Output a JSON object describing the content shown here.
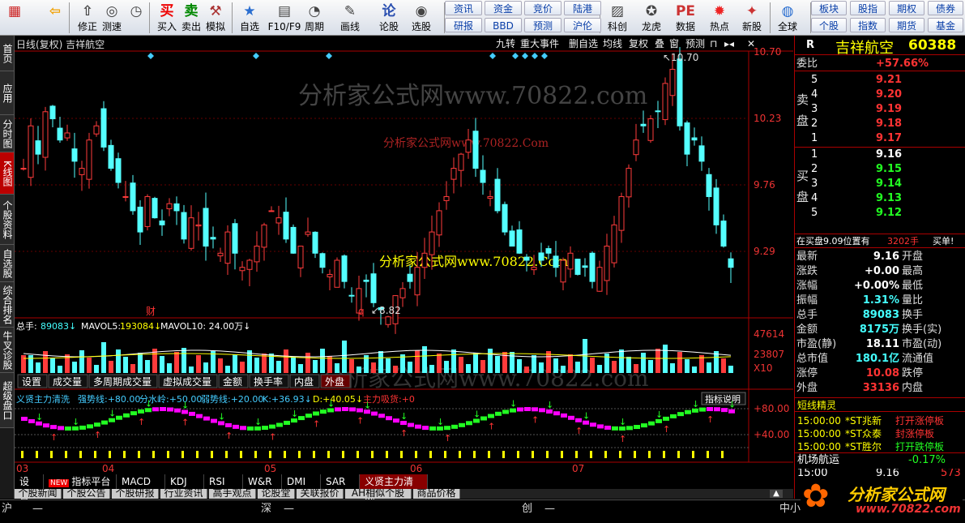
{
  "toolbar": {
    "buttons": [
      {
        "label": "",
        "icon": "grid-icon"
      },
      {
        "label": "",
        "icon": "back-arrow-icon"
      },
      {
        "label": "修正",
        "icon": "up-arrow-icon"
      },
      {
        "label": "测速",
        "icon": "bulb-icon"
      },
      {
        "label": "",
        "icon": "clock-icon"
      },
      {
        "label": "买入",
        "icon": "buy-icon",
        "glyph": "买"
      },
      {
        "label": "卖出",
        "icon": "sell-icon",
        "glyph": "卖"
      },
      {
        "label": "模拟",
        "icon": "hammer-icon"
      },
      {
        "label": "自选",
        "icon": "star-icon"
      },
      {
        "label": "F10/F9",
        "icon": "f10-icon"
      },
      {
        "label": "周期",
        "icon": "cycle-icon"
      },
      {
        "label": "画线",
        "icon": "pen-icon"
      },
      {
        "label": "论股",
        "icon": "chat-icon",
        "glyph": "论"
      },
      {
        "label": "选股",
        "icon": "select-icon"
      },
      {
        "label": "科创",
        "icon": "chart-icon"
      },
      {
        "label": "龙虎",
        "icon": "tiger-icon"
      },
      {
        "label": "数据",
        "icon": "pe-icon",
        "glyph": "PE"
      },
      {
        "label": "热点",
        "icon": "hot-icon"
      },
      {
        "label": "新股",
        "icon": "new-icon"
      },
      {
        "label": "全球",
        "icon": "globe-icon"
      }
    ],
    "links_top": [
      "资讯",
      "资金",
      "竞价",
      "陆港"
    ],
    "links_bottom": [
      "研报",
      "BBD",
      "预测",
      "沪伦"
    ],
    "right_top": [
      "板块",
      "股指",
      "期权",
      "债券"
    ],
    "right_bottom": [
      "个股",
      "指数",
      "期货",
      "基金"
    ]
  },
  "left_tabs": [
    "首页",
    "应用",
    "分时图",
    "K线图",
    "个股资料",
    "自选股",
    "综合排名",
    "牛叉诊股",
    "超级盘口"
  ],
  "chart": {
    "title": "日线(复权) 吉祥航空",
    "menu": [
      "九转",
      "重大事件",
      "删自选",
      "均线",
      "复权",
      "叠",
      "窗",
      "预测"
    ],
    "price_labels": [
      "10.70",
      "10.23",
      "9.76",
      "9.29"
    ],
    "high_annot": "10.70",
    "low_annot": "8.82",
    "fin_marker": "财",
    "q_marker": "q",
    "watermark1": "分析家公式网www.70822.com",
    "watermark2": "分析家公式网www.70822.Com",
    "watermark3": "分析家公式网www.70822.Com",
    "watermark4": "分析家公式网www.70822.com"
  },
  "volume": {
    "label_total": "总手:",
    "total": "89083",
    "label_ma5": "MAVOL5:",
    "ma5": "193084",
    "label_ma10": "MAVOL10:",
    "ma10": "24.00万",
    "ticks": [
      "47614",
      "23807",
      "X10"
    ],
    "tabs": [
      "设置",
      "成交量",
      "多周期成交量",
      "虚拟成交量",
      "金额",
      "换手率",
      "内盘",
      "外盘"
    ]
  },
  "indicator": {
    "name": "义贤主力清洗",
    "parts": [
      {
        "label": "强势线:",
        "value": "+80.00"
      },
      {
        "label": "分水岭:",
        "value": "+50.00"
      },
      {
        "label": "弱势线:",
        "value": "+20.00"
      },
      {
        "label": "K:",
        "value": "+36.93"
      },
      {
        "label": "D:",
        "value": "+40.05"
      },
      {
        "label": "主力吸货:",
        "value": "+0"
      }
    ],
    "help": "指标说明",
    "ticks": [
      "+80.00",
      "+40.00"
    ]
  },
  "months": [
    "03",
    "04",
    "05",
    "06",
    "07"
  ],
  "bottom_tabs": [
    "设置",
    "指标平台",
    "MACD",
    "KDJ",
    "RSI",
    "W&R",
    "DMI",
    "SAR",
    "义贤主力清洗"
  ],
  "new_badge": "NEW",
  "news_tabs": [
    "个股新闻",
    "个股公告",
    "个股研报",
    "行业资讯",
    "高手观点",
    "论股堂",
    "关联报价",
    "AH相似个股",
    "商品价格"
  ],
  "status": {
    "sh": "沪",
    "sh_v": "—",
    "sz": "深",
    "sz_v": "—",
    "cy": "创",
    "cy_v": "—",
    "zx": "中小"
  },
  "quote": {
    "code_prefix": "R",
    "name": "吉祥航空",
    "code": "60388",
    "weibi_label": "委比",
    "weibi": "+57.66%",
    "sell_label": "卖盘",
    "buy_label": "买盘",
    "sell": [
      {
        "n": "5",
        "p": "9.21"
      },
      {
        "n": "4",
        "p": "9.20"
      },
      {
        "n": "3",
        "p": "9.19"
      },
      {
        "n": "2",
        "p": "9.18"
      },
      {
        "n": "1",
        "p": "9.17"
      }
    ],
    "buy": [
      {
        "n": "1",
        "p": "9.16"
      },
      {
        "n": "2",
        "p": "9.15"
      },
      {
        "n": "3",
        "p": "9.14"
      },
      {
        "n": "4",
        "p": "9.13"
      },
      {
        "n": "5",
        "p": "9.12"
      }
    ],
    "notice": "在买盘9.09位置有",
    "notice_vol": "3202手",
    "notice_act": "买单!",
    "stats": [
      {
        "l": "最新",
        "v": "9.16",
        "r": "开盘",
        "c": "wht"
      },
      {
        "l": "涨跌",
        "v": "+0.00",
        "r": "最高",
        "c": "wht"
      },
      {
        "l": "涨幅",
        "v": "+0.00%",
        "r": "最低",
        "c": "wht"
      },
      {
        "l": "振幅",
        "v": "1.31%",
        "r": "量比",
        "c": "cyn"
      },
      {
        "l": "总手",
        "v": "89083",
        "r": "换手",
        "c": "cyn"
      },
      {
        "l": "金额",
        "v": "8175万",
        "r": "换手(实)",
        "c": "cyn"
      },
      {
        "l": "市盈(静)",
        "v": "18.11",
        "r": "市盈(动)",
        "c": "wht"
      },
      {
        "l": "总市值",
        "v": "180.1亿",
        "r": "流通值",
        "c": "cyn"
      },
      {
        "l": "涨停",
        "v": "10.08",
        "r": "跌停",
        "c": "red"
      },
      {
        "l": "外盘",
        "v": "33136",
        "r": "内盘",
        "c": "red"
      }
    ],
    "jingling": "短线精灵",
    "events": [
      {
        "t": "15:00:00",
        "n": "*ST兆新",
        "e": "打开涨停板"
      },
      {
        "t": "15:00:00",
        "n": "*ST众泰",
        "e": "封涨停板"
      },
      {
        "t": "15:00:00",
        "n": "*ST胜尔",
        "e": "打开跌停板"
      }
    ],
    "sector": "机场航运",
    "sector_chg": "-0.17%",
    "last_time": "15:00",
    "last_price": "9.16",
    "last_vol": "573"
  },
  "logo": {
    "text": "分析家公式网",
    "url": "www.70822.com"
  },
  "colors": {
    "up": "#ff3b3b",
    "down": "#54ffff",
    "bg": "#000000",
    "accent": "#c00000"
  }
}
